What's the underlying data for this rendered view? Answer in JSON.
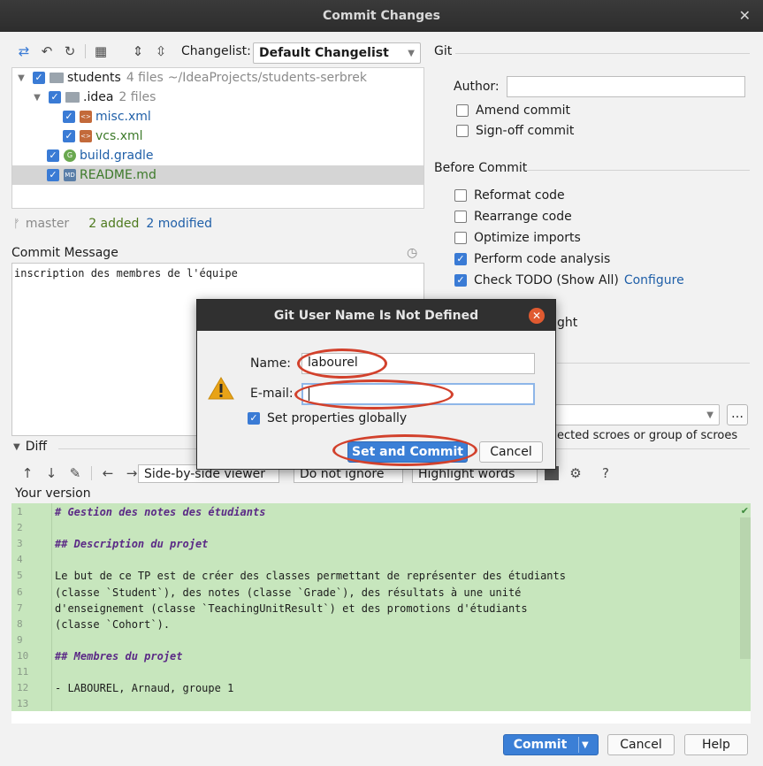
{
  "window": {
    "title": "Commit Changes"
  },
  "toolbar": {
    "changelist_label": "Changelist:",
    "changelist_value": "Default Changelist"
  },
  "tree": {
    "root": {
      "name": "students",
      "meta": "4 files",
      "path": "~/IdeaProjects/students-serbrek"
    },
    "idea": {
      "name": ".idea",
      "meta": "2 files"
    },
    "files": [
      {
        "name": "misc.xml",
        "icon": "xml"
      },
      {
        "name": "vcs.xml",
        "icon": "xml"
      },
      {
        "name": "build.gradle",
        "icon": "G"
      },
      {
        "name": "README.md",
        "icon": "MD"
      }
    ]
  },
  "status": {
    "branch": "master",
    "added": "2 added",
    "modified": "2 modified"
  },
  "commit_message": {
    "label": "Commit Message",
    "text": "inscription des membres de l'équipe"
  },
  "git_panel": {
    "title": "Git",
    "author_label": "Author:",
    "amend": "Amend commit",
    "signoff": "Sign-off commit",
    "before_commit_title": "Before Commit",
    "options": [
      {
        "label": "Reformat code",
        "checked": false
      },
      {
        "label": "Rearrange code",
        "checked": false
      },
      {
        "label": "Optimize imports",
        "checked": false
      },
      {
        "label": "Perform code analysis",
        "checked": true
      },
      {
        "label": "Check TODO (Show All)",
        "checked": true
      }
    ],
    "configure": "Configure",
    "partial_1": "ght",
    "partial_2": "ected scroes or group of scroes"
  },
  "diff": {
    "label": "Diff",
    "viewer": "Side-by-side viewer",
    "ignore": "Do not ignore",
    "highlight": "Highlight words",
    "your_version": "Your version",
    "lines": [
      {
        "n": "1",
        "t": "# Gestion des notes des étudiants",
        "h": true
      },
      {
        "n": "2",
        "t": "",
        "h": false
      },
      {
        "n": "3",
        "t": "## Description du projet",
        "h": true
      },
      {
        "n": "4",
        "t": "",
        "h": false
      },
      {
        "n": "5",
        "t": "Le but de ce TP est de créer des classes permettant de représenter des étudiants",
        "h": false
      },
      {
        "n": "6",
        "t": "(classe `Student`), des notes (classe `Grade`), des résultats à une unité",
        "h": false
      },
      {
        "n": "7",
        "t": "d'enseignement (classe `TeachingUnitResult`) et des promotions d'étudiants",
        "h": false
      },
      {
        "n": "8",
        "t": "(classe `Cohort`).",
        "h": false
      },
      {
        "n": "9",
        "t": "",
        "h": false
      },
      {
        "n": "10",
        "t": "## Membres du projet",
        "h": true
      },
      {
        "n": "11",
        "t": "",
        "h": false
      },
      {
        "n": "12",
        "t": "- LABOUREL, Arnaud, groupe 1",
        "h": false
      },
      {
        "n": "13",
        "t": "",
        "h": false
      }
    ]
  },
  "buttons": {
    "commit": "Commit",
    "cancel": "Cancel",
    "help": "Help"
  },
  "dialog": {
    "title": "Git User Name Is Not Defined",
    "name_label": "Name:",
    "name_value": "labourel",
    "email_label": "E-mail:",
    "email_value": "",
    "set_globally": "Set properties globally",
    "set_and_commit": "Set and Commit",
    "cancel": "Cancel"
  },
  "colors": {
    "accent": "#3b7fd6",
    "annotation_ring": "#d2412c",
    "diff_bg": "#c7e6bd"
  }
}
